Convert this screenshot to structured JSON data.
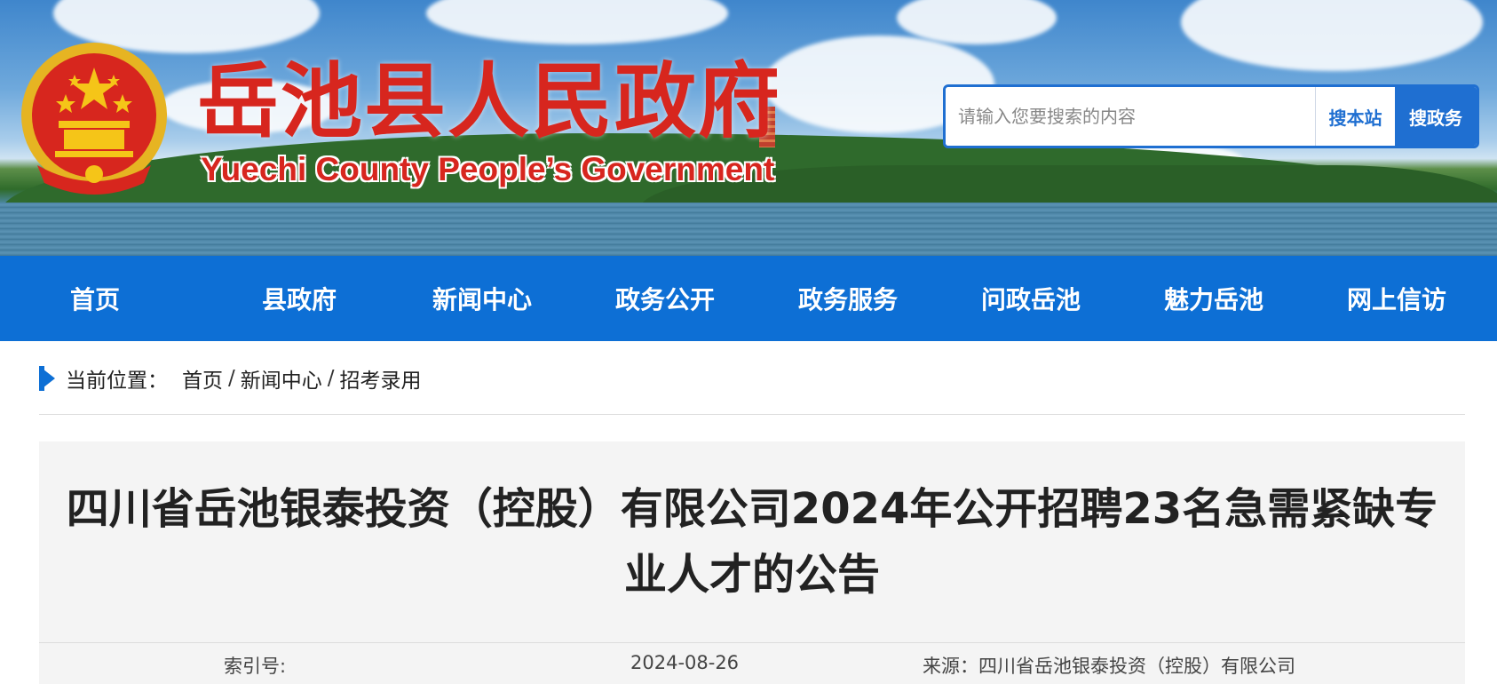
{
  "header": {
    "title": "岳池县人民政府",
    "subtitle": "Yuechi County People’s Government",
    "emblem_icon": "national-emblem-icon",
    "title_color": "#d7261e"
  },
  "search": {
    "placeholder": "请输入您要搜索的内容",
    "button_site": "搜本站",
    "button_gov": "搜政务",
    "accent_color": "#1f6fd1"
  },
  "nav": {
    "background": "#0d6fd5",
    "items": [
      "首页",
      "县政府",
      "新闻中心",
      "政务公开",
      "政务服务",
      "问政岳池",
      "魅力岳池",
      "网上信访"
    ]
  },
  "breadcrumb": {
    "label": "当前位置：",
    "items": [
      "首页",
      "新闻中心",
      "招考录用"
    ],
    "separator": "/"
  },
  "article": {
    "title": "四川省岳池银泰投资（控股）有限公司2024年公开招聘23名急需紧缺专业人才的公告",
    "index_label": "索引号:",
    "date": "2024-08-26",
    "source": "来源：四川省岳池银泰投资（控股）有限公司"
  }
}
